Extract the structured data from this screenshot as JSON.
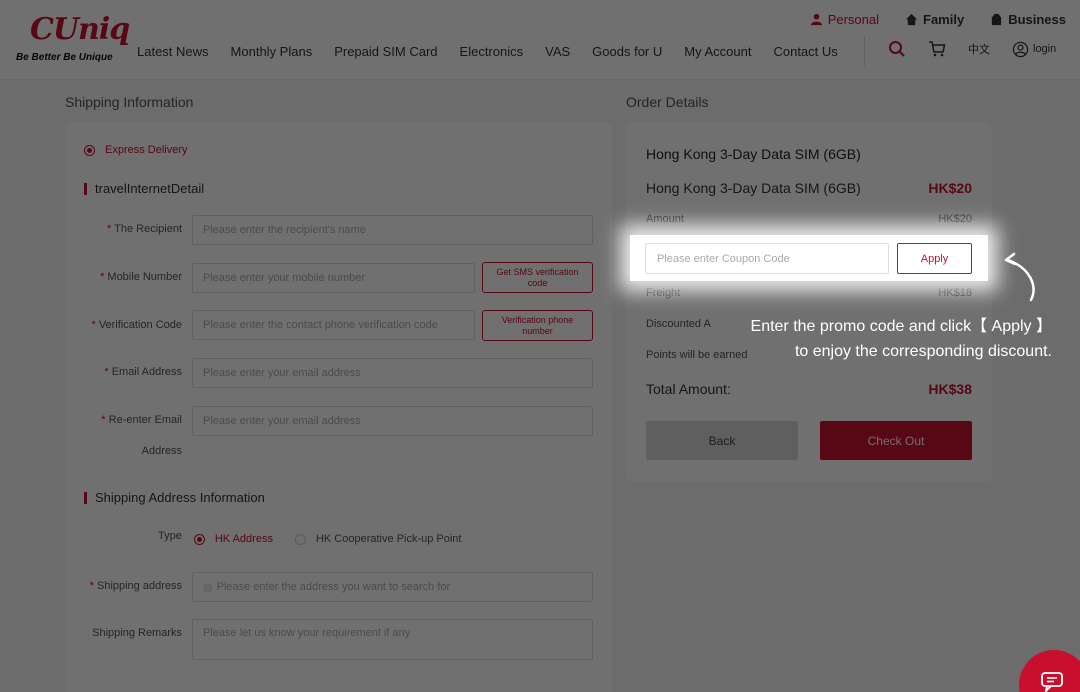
{
  "header": {
    "logo_text": "CUniq",
    "logo_tagline": "Be Better Be Unique",
    "nav": [
      "Latest News",
      "Monthly Plans",
      "Prepaid SIM Card",
      "Electronics",
      "VAS",
      "Goods for U",
      "My Account",
      "Contact Us"
    ],
    "segments": {
      "personal": "Personal",
      "family": "Family",
      "business": "Business"
    },
    "language": "中文",
    "login": "login"
  },
  "shipping": {
    "title": "Shipping Information",
    "delivery_option": "Express Delivery",
    "detail_title": "travelInternetDetail",
    "fields": {
      "recipient": {
        "label": "The Recipient",
        "placeholder": "Please enter the recipient's name"
      },
      "mobile": {
        "label": "Mobile Number",
        "placeholder": "Please enter your mobile number",
        "button": "Get SMS verification code"
      },
      "verification": {
        "label": "Verification Code",
        "placeholder": "Please enter the contact phone verification code",
        "button": "Verification phone number"
      },
      "email": {
        "label": "Email Address",
        "placeholder": "Please enter your email address"
      },
      "reemail": {
        "label_line1": "Re-enter Email",
        "label_line2": "Address",
        "placeholder": "Please enter your email address"
      }
    },
    "address_title": "Shipping Address Information",
    "type_label": "Type",
    "type_options": [
      "HK Address",
      "HK Cooperative Pick-up Point"
    ],
    "shipping_address": {
      "label": "Shipping address",
      "placeholder": "Please enter the address you want to search for"
    },
    "remarks": {
      "label": "Shipping Remarks",
      "placeholder": "Please let us know your requirement if any"
    }
  },
  "order": {
    "title": "Order Details",
    "product_title": "Hong Kong 3-Day Data SIM  (6GB)",
    "product_name": "Hong Kong 3-Day Data SIM  (6GB)",
    "product_price": "HK$20",
    "amount_label": "Amount",
    "amount_value": "HK$20",
    "coupon_placeholder": "Please enter Coupon Code",
    "apply_label": "Apply",
    "freight_label": "Freight",
    "freight_value": "HK$18",
    "discounted_label": "Discounted A",
    "points_label": "Points will be earned",
    "total_label": "Total Amount:",
    "total_value": "HK$38",
    "back_label": "Back",
    "checkout_label": "Check Out"
  },
  "tooltip": {
    "line1": "Enter the promo code and click【 Apply 】",
    "line2": "to enjoy the corresponding discount."
  },
  "colors": {
    "brand": "#c8102e",
    "overlay": "rgba(0,0,0,0.56)"
  },
  "icons": [
    "person-icon",
    "home-icon",
    "building-icon",
    "search-icon",
    "cart-icon",
    "user-circle-icon",
    "location-pin-icon",
    "curved-arrow-icon",
    "chat-icon"
  ]
}
